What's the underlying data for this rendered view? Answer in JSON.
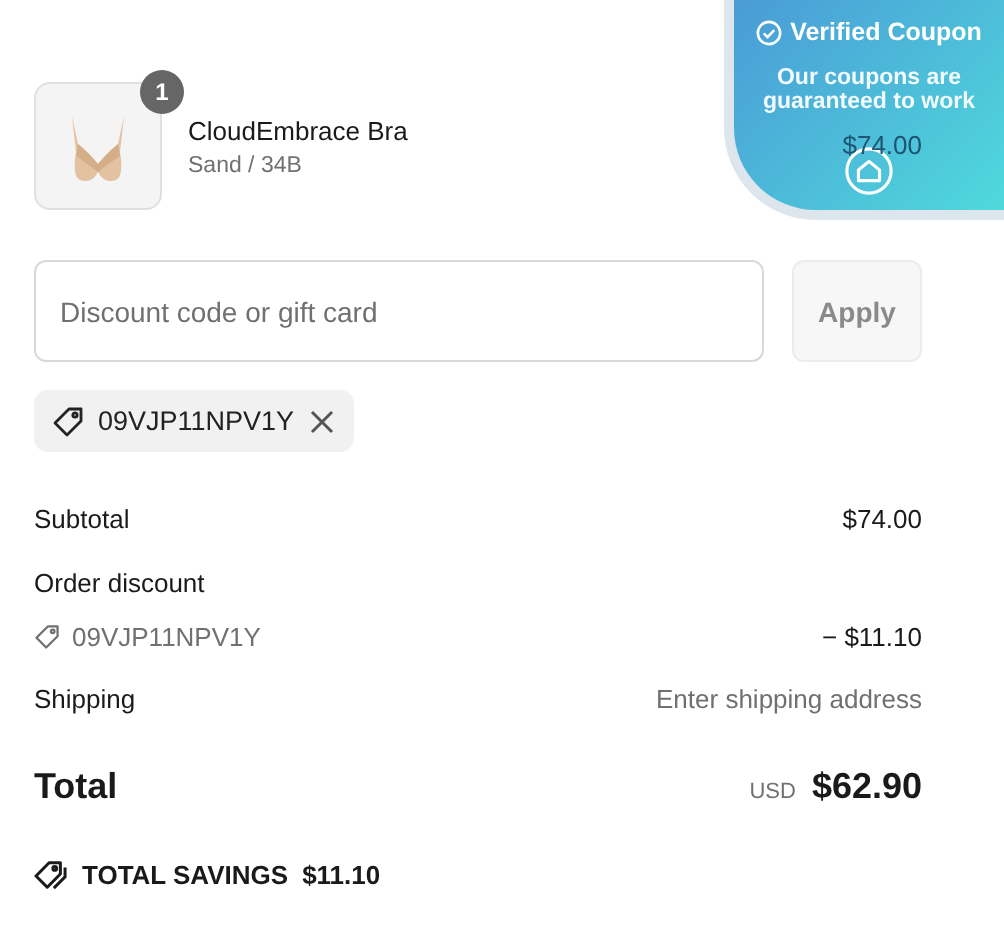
{
  "product": {
    "name": "CloudEmbrace Bra",
    "variant": "Sand / 34B",
    "quantity": "1",
    "price": "$74.00"
  },
  "discount": {
    "placeholder": "Discount code or gift card",
    "button": {
      "label": "Apply",
      "disabled": true
    },
    "applied_codes": [
      "09VJP11NPV1Y"
    ]
  },
  "summary": {
    "subtotal": {
      "label": "Subtotal",
      "value": "$74.00"
    },
    "order_discount": {
      "label": "Order discount",
      "code": "09VJP11NPV1Y",
      "value": "− $11.10"
    },
    "shipping": {
      "label": "Shipping",
      "value": "Enter shipping address"
    },
    "total": {
      "label": "Total",
      "currency": "USD",
      "value": "$62.90"
    }
  },
  "savings": {
    "label": "TOTAL SAVINGS",
    "value": "$11.10"
  },
  "coupon_overlay": {
    "title": "Verified Coupon",
    "message": "Our coupons are guaranteed to work"
  }
}
